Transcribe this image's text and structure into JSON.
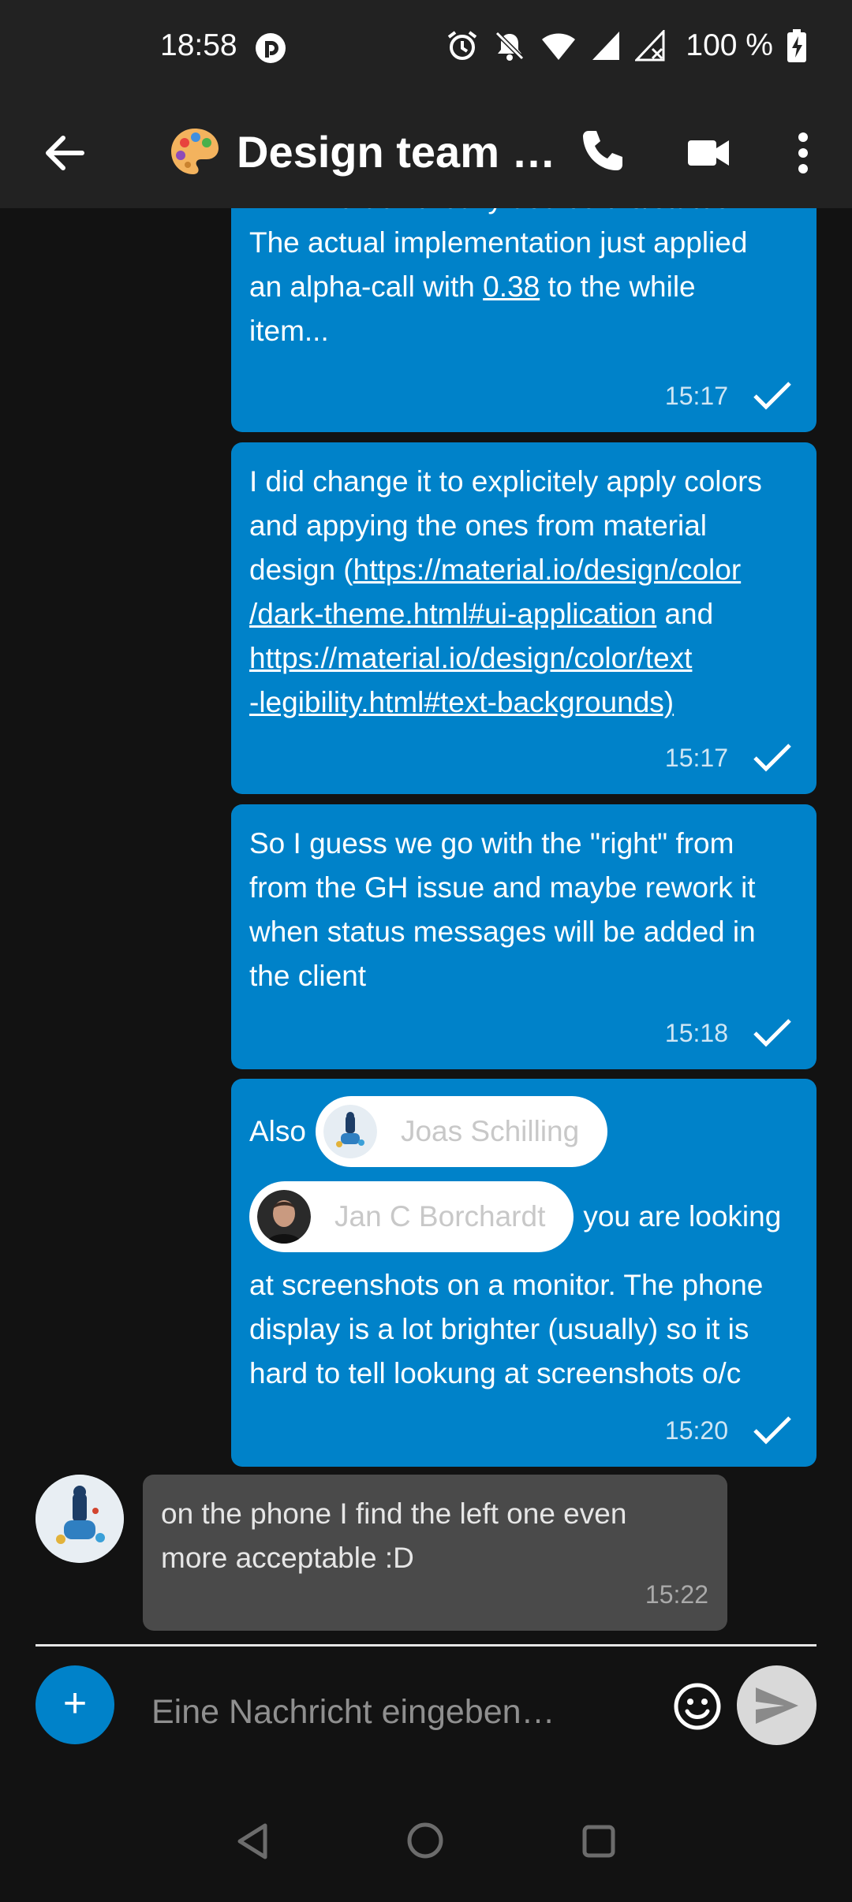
{
  "status_bar": {
    "time": "18:58",
    "battery": "100 %",
    "icons": [
      "pocket-casts-icon",
      "alarm-icon",
      "bell-off-icon",
      "wifi-icon",
      "signal-icon",
      "signal-x-icon",
      "battery-charging-icon"
    ]
  },
  "toolbar": {
    "emoji": "palette-icon",
    "title": "Design team …",
    "back_icon": "arrow-left-icon",
    "call_icon": "phone-icon",
    "video_icon": "video-icon",
    "more_icon": "more-vert-icon"
  },
  "messages": [
    {
      "line1": "ATM we don't really use colors/states.",
      "line2": "The actual implementation just applied",
      "line3_pre": "an alpha-call with ",
      "line3_link": "0.38",
      "line3_post": " to the while",
      "line4": "item...",
      "time": "15:17"
    },
    {
      "line1": "I did change it to explicitely apply colors",
      "line2": "and appying the ones from material",
      "line3_pre": "design (",
      "line3_link": "https://material.io/design/color",
      "line4_link": "/dark-theme.html#ui-application",
      "line4_post": " and",
      "line5_link": "https://material.io/design/color/text",
      "line6_link": "-legibility.html#text-backgrounds)",
      "time": "15:17"
    },
    {
      "line1": "So I guess we go with the \"right\" from",
      "line2": "from the GH issue and maybe rework it",
      "line3": "when status messages will be added in",
      "line4": "the client",
      "time": "15:18"
    },
    {
      "pre": "Also",
      "mention1": "Joas Schilling",
      "mention2": "Jan C Borchardt",
      "post": "you are looking",
      "line3": "at screenshots on a monitor. The phone",
      "line4": "display is a lot brighter (usually) so it is",
      "line5": "hard to tell lookung at screenshots o/c",
      "time": "15:20"
    },
    {
      "line1": "on the phone I find the left one even",
      "line2": "more acceptable :D",
      "time": "15:22"
    }
  ],
  "composer": {
    "add_label": "+",
    "placeholder": "Eine Nachricht eingeben…",
    "emoji_icon": "smiley-icon",
    "send_icon": "send-icon"
  },
  "navbar": {
    "icons": [
      "nav-back-icon",
      "nav-home-icon",
      "nav-recents-icon"
    ]
  },
  "colors": {
    "accent": "#0082c9",
    "bar": "#222222",
    "background": "#121212",
    "incoming_bubble": "#4a4a4a"
  }
}
